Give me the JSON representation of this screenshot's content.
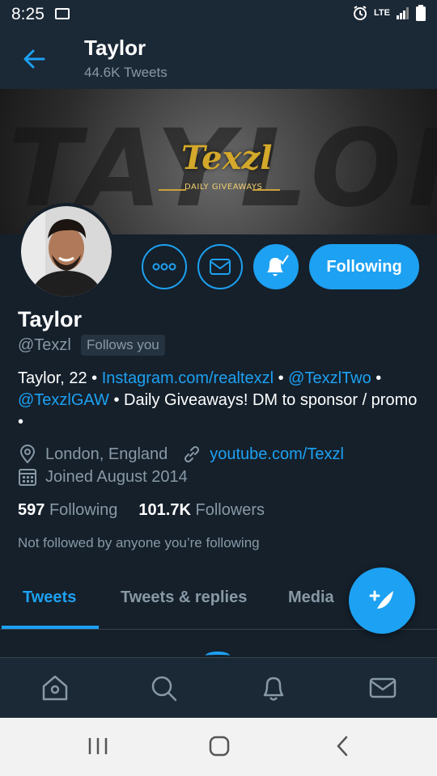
{
  "status_bar": {
    "time": "8:25",
    "network": "LTE",
    "icons": [
      "image-icon",
      "alarm-icon",
      "lte-icon",
      "signal-icon",
      "battery-icon"
    ]
  },
  "header": {
    "name": "Taylor",
    "tweet_count": "44.6K Tweets"
  },
  "banner": {
    "background_text": "TAYLOR",
    "logo_text": "Texzl",
    "tagline": "DAILY GIVEAWAYS"
  },
  "actions": {
    "more_icon": "more-icon",
    "message_icon": "mail-icon",
    "notifications_icon": "bell-icon",
    "following_label": "Following"
  },
  "profile": {
    "name": "Taylor",
    "handle": "@Texzl",
    "follows_you": "Follows you",
    "bio_parts": [
      {
        "text": "Taylor, 22 • ",
        "link": false
      },
      {
        "text": "Instagram.com/realtexzl",
        "link": true
      },
      {
        "text": " • ",
        "link": false
      },
      {
        "text": "@TexzlTwo",
        "link": true
      },
      {
        "text": " • ",
        "link": false
      },
      {
        "text": "@TexzlGAW",
        "link": true
      },
      {
        "text": " • Daily Giveaways! DM to sponsor / promo •",
        "link": false
      }
    ],
    "location": "London, England",
    "website": "youtube.com/Texzl",
    "joined": "Joined August 2014",
    "following_count": "597",
    "following_label": "Following",
    "followers_count": "101.7K",
    "followers_label": "Followers",
    "followed_by": "Not followed by anyone you’re following"
  },
  "tabs": [
    {
      "label": "Tweets",
      "active": true
    },
    {
      "label": "Tweets & replies",
      "active": false
    },
    {
      "label": "Media",
      "active": false
    }
  ],
  "bottom_nav": [
    "home-icon",
    "search-icon",
    "notifications-icon",
    "messages-icon"
  ],
  "android_nav": [
    "recents-icon",
    "home-icon",
    "back-icon"
  ],
  "colors": {
    "background": "#15202b",
    "header": "#1b2836",
    "accent": "#1da1f2",
    "secondary_text": "#8899a6"
  }
}
